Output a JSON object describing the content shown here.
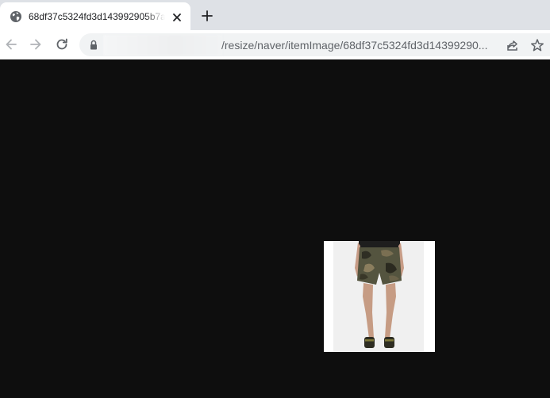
{
  "tab": {
    "title": "68df37c5324fd3d143992905b7a",
    "favicon": "globe-icon",
    "close_icon": "close-icon"
  },
  "new_tab": {
    "icon": "plus-icon"
  },
  "toolbar": {
    "back_icon": "back-arrow-icon",
    "forward_icon": "forward-arrow-icon",
    "reload_icon": "reload-icon",
    "lock_icon": "lock-icon",
    "url_visible": "/resize/naver/itemImage/68df37c5324fd3d14399290...",
    "share_icon": "share-icon",
    "bookmark_icon": "star-icon"
  },
  "page": {
    "background": "#0e0e0e",
    "image": {
      "description": "product-photo-camo-shorts",
      "background": "#f2f2f2"
    }
  },
  "colors": {
    "tabstrip": "#dee1e6",
    "toolbar": "#ffffff",
    "omnibox": "#f1f3f4",
    "icon": "#5f6368"
  }
}
